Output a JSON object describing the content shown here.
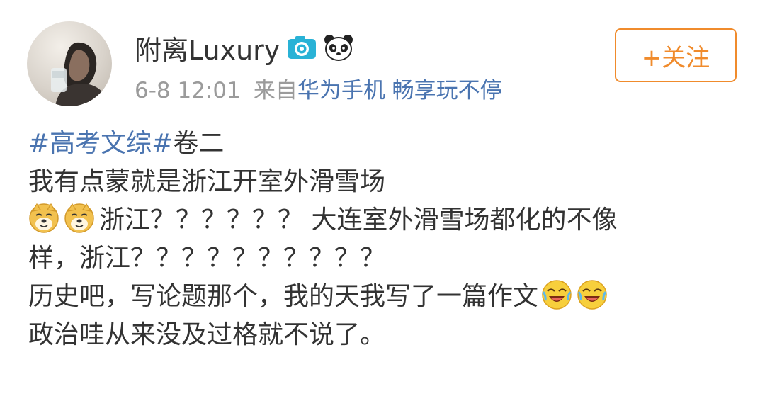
{
  "post": {
    "username": "附离Luxury",
    "badges": [
      {
        "icon": "camera-badge-icon",
        "color": "#29b2d6"
      },
      {
        "icon": "panda-badge-icon",
        "color": "#222222"
      }
    ],
    "time": "6-8 12:01",
    "from_label": "来自",
    "source": "华为手机 畅享玩不停",
    "follow_button": "+关注",
    "lines": {
      "line1_topic": "#高考文综#",
      "line1_rest": "卷二",
      "line2": "我有点蒙就是浙江开室外滑雪场",
      "line3": "浙江？？？？？？ 大连室外滑雪场都化的不像",
      "line4": "样，浙江？？？？？？？？？？",
      "line5": "历史吧，写论题那个，我的天我写了一篇作文",
      "line6": "政治哇从来没及过格就不说了。"
    },
    "emojis": {
      "line3_prefix": [
        "doge-emoji",
        "doge-emoji"
      ],
      "line5_suffix": [
        "laugh-cry-emoji",
        "laugh-cry-emoji"
      ]
    }
  },
  "colors": {
    "link": "#4a74b0",
    "accent": "#f08b2c",
    "meta": "#9b9b9b",
    "text": "#333333"
  }
}
